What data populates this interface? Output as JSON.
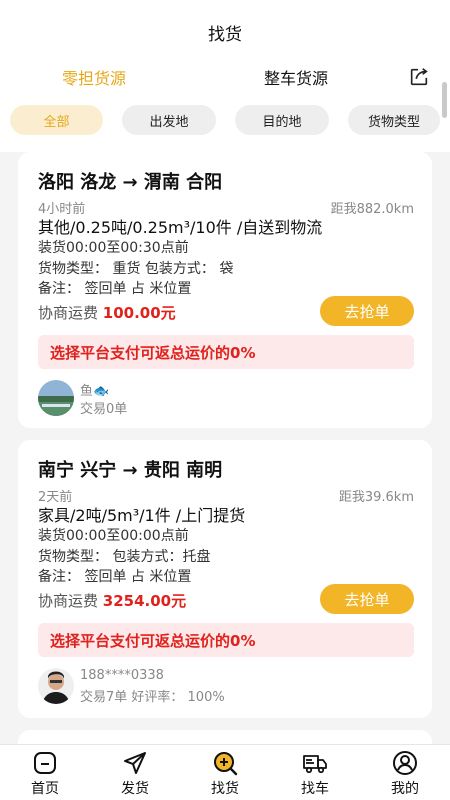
{
  "header": {
    "title": "找货"
  },
  "main_tabs": [
    {
      "label": "零担货源",
      "active": true
    },
    {
      "label": "整车货源",
      "active": false
    }
  ],
  "filter_chips": [
    {
      "label": "全部",
      "active": true
    },
    {
      "label": "出发地",
      "active": false
    },
    {
      "label": "目的地",
      "active": false
    },
    {
      "label": "货物类型",
      "active": false
    }
  ],
  "cards": [
    {
      "route": "洛阳 洛龙 → 渭南 合阳",
      "time": "4小时前",
      "distance": "距我882.0km",
      "cargo": "其他/0.25吨/0.25m³/10件 /自送到物流",
      "loading": "装货00:00至00:30点前",
      "type_pack": "货物类型：   重货    包装方式：   袋",
      "remark": "备注：   签回单  占  米位置",
      "fee_label": "协商运费",
      "fee_value": "100.00元",
      "grab_label": "去抢单",
      "promo": "选择平台支付可返总运价的0%",
      "user_name": "鱼🐟",
      "user_stats": "交易0单"
    },
    {
      "route": "南宁 兴宁 → 贵阳 南明",
      "time": "2天前",
      "distance": "距我39.6km",
      "cargo": "家具/2吨/5m³/1件 /上门提货",
      "loading": "装货00:00至00:00点前",
      "type_pack": "货物类型：     包装方式：托盘",
      "remark": "备注：   签回单  占  米位置",
      "fee_label": "协商运费",
      "fee_value": "3254.00元",
      "grab_label": "去抢单",
      "promo": "选择平台支付可返总运价的0%",
      "user_name": "188****0338",
      "user_stats": "交易7单     好评率：   100%"
    }
  ],
  "bottom_nav": [
    {
      "label": "首页",
      "icon": "home-icon"
    },
    {
      "label": "发货",
      "icon": "send-icon"
    },
    {
      "label": "找货",
      "icon": "search-goods-icon",
      "active": true
    },
    {
      "label": "找车",
      "icon": "truck-icon"
    },
    {
      "label": "我的",
      "icon": "profile-icon"
    }
  ],
  "colors": {
    "accent": "#e6a817",
    "button": "#f2b528",
    "price_red": "#e0221c",
    "promo_bg": "#fde8ea"
  }
}
